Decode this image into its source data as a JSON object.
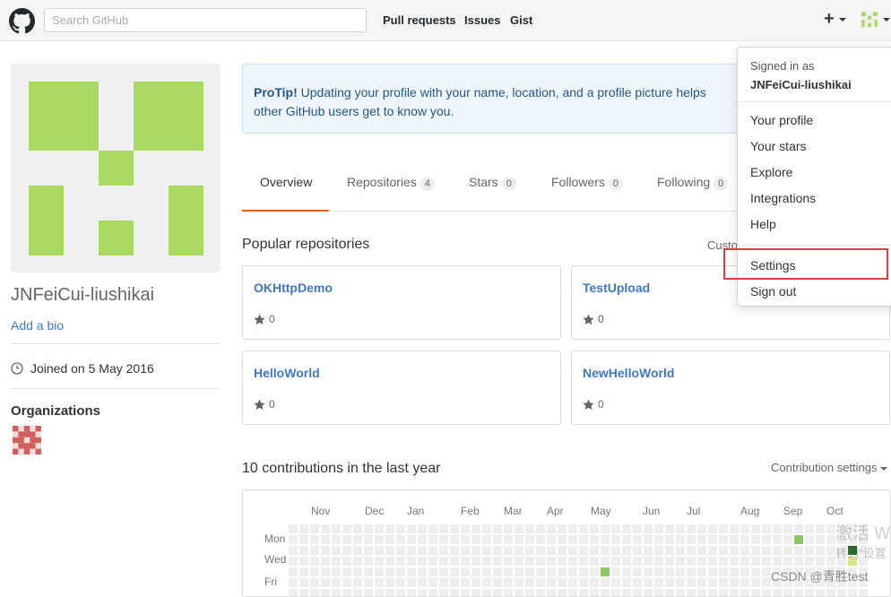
{
  "header": {
    "search_placeholder": "Search GitHub",
    "nav": [
      "Pull requests",
      "Issues",
      "Gist"
    ],
    "new_label": "+",
    "avatar_icon": "identicon-green"
  },
  "profile": {
    "username": "JNFeiCui-liushikai",
    "add_bio": "Add a bio",
    "joined": "Joined on 5 May 2016",
    "organizations_title": "Organizations",
    "avatar_color": "#aad962",
    "org_avatar_color": "#d0605e"
  },
  "protip": {
    "label": "ProTip!",
    "text": " Updating your profile with your name, location, and a profile picture helps other GitHub users get to know you."
  },
  "tabs": [
    {
      "label": "Overview",
      "count": ""
    },
    {
      "label": "Repositories",
      "count": "4"
    },
    {
      "label": "Stars",
      "count": "0"
    },
    {
      "label": "Followers",
      "count": "0"
    },
    {
      "label": "Following",
      "count": "0"
    }
  ],
  "popular": {
    "title": "Popular repositories",
    "customize": "Custo",
    "repos": [
      {
        "name": "OKHttpDemo",
        "stars": "0"
      },
      {
        "name": "TestUpload",
        "stars": "0"
      },
      {
        "name": "HelloWorld",
        "stars": "0"
      },
      {
        "name": "NewHelloWorld",
        "stars": "0"
      }
    ]
  },
  "contributions": {
    "title": "10 contributions in the last year",
    "settings": "Contribution settings",
    "months": [
      "Nov",
      "Dec",
      "Jan",
      "Feb",
      "Mar",
      "Apr",
      "May",
      "Jun",
      "Jul",
      "Aug",
      "Sep",
      "Oct"
    ],
    "days": [
      "Mon",
      "Wed",
      "Fri"
    ]
  },
  "dropdown": {
    "signed_in_as": "Signed in as",
    "user": "JNFeiCui-liushikai",
    "items": [
      "Your profile",
      "Your stars",
      "Explore",
      "Integrations",
      "Help"
    ],
    "settings": "Settings",
    "sign_out": "Sign out"
  },
  "overlay": {
    "watermark": "激活 W",
    "watermark_sub": "转到\"设置",
    "csdn": "CSDN @青胜test"
  }
}
